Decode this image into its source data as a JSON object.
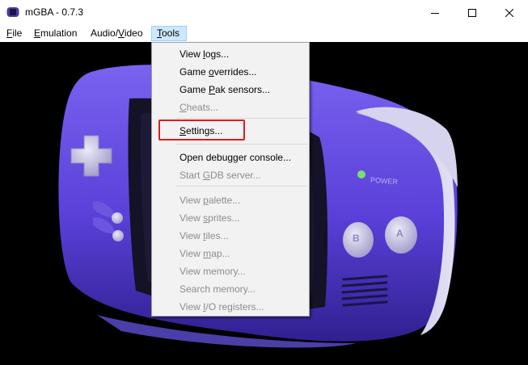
{
  "window": {
    "title": "mGBA - 0.7.3"
  },
  "menubar": {
    "file": {
      "u": "F",
      "rest": "ile"
    },
    "emulation": {
      "u": "E",
      "rest": "mulation"
    },
    "audio_video": {
      "pre": "Audio/",
      "u": "V",
      "rest": "ideo"
    },
    "tools": {
      "u": "T",
      "rest": "ools"
    }
  },
  "tools_menu": {
    "view_logs": {
      "pre": "View ",
      "u": "l",
      "rest": "ogs..."
    },
    "game_overrides": {
      "pre": "Game ",
      "u": "o",
      "rest": "verrides..."
    },
    "game_pak_sensors": {
      "pre": "Game ",
      "u": "P",
      "rest": "ak sensors..."
    },
    "cheats": {
      "pre": "",
      "u": "C",
      "rest": "heats..."
    },
    "settings": {
      "pre": "",
      "u": "S",
      "rest": "ettings..."
    },
    "open_debugger_console": {
      "pre": "Open debugger console..."
    },
    "start_gdb_server": {
      "pre": "Start ",
      "u": "G",
      "rest": "DB server..."
    },
    "view_palette": {
      "pre": "View ",
      "u": "p",
      "rest": "alette..."
    },
    "view_sprites": {
      "pre": "View ",
      "u": "s",
      "rest": "prites..."
    },
    "view_tiles": {
      "pre": "View ",
      "u": "t",
      "rest": "iles..."
    },
    "view_map": {
      "pre": "View ",
      "u": "m",
      "rest": "ap..."
    },
    "view_memory": {
      "pre": "View memory..."
    },
    "search_memory": {
      "pre": "Search memory..."
    },
    "view_io_registers": {
      "pre": "View ",
      "u": "I",
      "rest": "/O registers..."
    }
  },
  "console": {
    "power_label": "POWER",
    "button_a": "A",
    "button_b": "B"
  },
  "colors": {
    "console_purple": "#5a40d8",
    "menu_hover": "#cce8ff",
    "highlight_box": "#e01c1c",
    "disabled_text": "#8c8c8c"
  }
}
